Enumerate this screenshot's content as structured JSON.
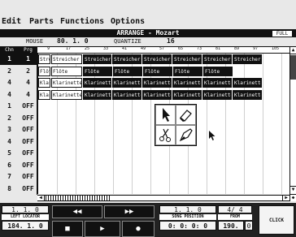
{
  "menu": [
    "Edit",
    "Parts",
    "Functions",
    "Options"
  ],
  "window": {
    "title": "ARRANGE - Mozart",
    "full_label": "FULL"
  },
  "infobar": {
    "mouse_label": "MOUSE",
    "mouse_value": "80. 1. 0",
    "quantize_label": "QUANTIZE",
    "quantize_value": "16"
  },
  "columns": {
    "chn": "Chn",
    "prg": "Prg"
  },
  "ruler": {
    "marks": [
      "9",
      "17",
      "25",
      "33",
      "41",
      "49",
      "57",
      "65",
      "73",
      "81",
      "89",
      "97",
      "105"
    ]
  },
  "tracks": [
    {
      "chn": "1",
      "prg": "1",
      "selected": true
    },
    {
      "chn": "2",
      "prg": "2",
      "selected": false
    },
    {
      "chn": "4",
      "prg": "4",
      "selected": false
    },
    {
      "chn": "4",
      "prg": "4",
      "selected": false
    },
    {
      "chn": "1",
      "prg": "OFF",
      "selected": false
    },
    {
      "chn": "2",
      "prg": "OFF",
      "selected": false
    },
    {
      "chn": "3",
      "prg": "OFF",
      "selected": false
    },
    {
      "chn": "4",
      "prg": "OFF",
      "selected": false
    },
    {
      "chn": "5",
      "prg": "OFF",
      "selected": false
    },
    {
      "chn": "6",
      "prg": "OFF",
      "selected": false
    },
    {
      "chn": "7",
      "prg": "OFF",
      "selected": false
    },
    {
      "chn": "8",
      "prg": "OFF",
      "selected": false
    }
  ],
  "parts": [
    {
      "track": 0,
      "items": [
        "Streic",
        "Streicher",
        "Streicher",
        "Streicher",
        "Streicher",
        "Streicher",
        "Streicher",
        "Streicher"
      ]
    },
    {
      "track": 1,
      "items": [
        "Flöte",
        "Flöte",
        "Flöte",
        "Flöte",
        "Flöte",
        "Flöte",
        "Flöte"
      ]
    },
    {
      "track": 2,
      "items": [
        "Klarin",
        "Klarinette",
        "Klarinette",
        "Klarinette",
        "Klarinette",
        "Klarinette",
        "Klarinette",
        "Klarinette"
      ]
    },
    {
      "track": 3,
      "items": [
        "Klarin",
        "Klarinette",
        "Klarinette",
        "Klarinette",
        "Klarinette",
        "Klarinette",
        "Klarinette",
        "Klarinette"
      ]
    }
  ],
  "toolbox": {
    "tools": [
      "arrow-icon",
      "eraser-icon",
      "scissors-icon",
      "glue-icon"
    ]
  },
  "transport": {
    "left_locator_value": "1. 1. 0",
    "left_locator_label": "LEFT LOCATOR",
    "position_value": "184. 1. 0",
    "song_position_bars": "1. 1. 0",
    "signature": "4/ 4",
    "song_position_label": "SONG POSITION",
    "from_label": "FROM",
    "position_time": "0: 0: 0: 0",
    "tempo": "190.",
    "mode": "0",
    "click_label": "CLICK"
  }
}
